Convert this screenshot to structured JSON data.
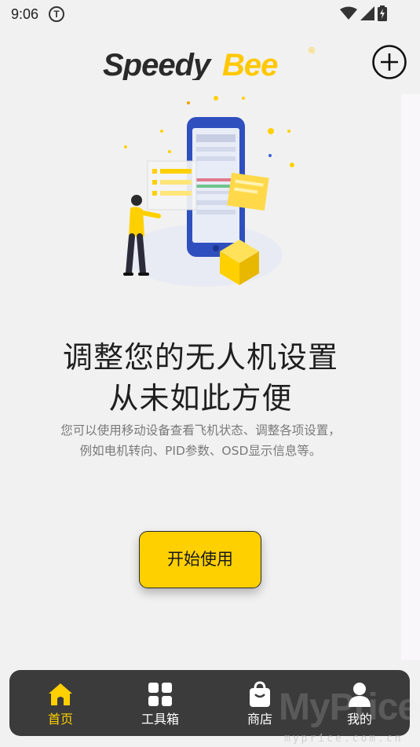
{
  "status_bar": {
    "time": "9:06",
    "carrier_icon": "T"
  },
  "header": {
    "brand_left": "Speedy",
    "brand_right": "Bee",
    "registered_mark": "®"
  },
  "main": {
    "headline_line1": "调整您的无人机设置",
    "headline_line2": "从未如此方便",
    "description_line1": "您可以使用移动设备查看飞机状态、调整各项设置，",
    "description_line2": "例如电机转向、PID参数、OSD显示信息等。",
    "start_button_label": "开始使用"
  },
  "tab_bar": {
    "tabs": [
      {
        "label": "首页",
        "icon": "home-icon",
        "active": true
      },
      {
        "label": "工具箱",
        "icon": "grid-icon",
        "active": false
      },
      {
        "label": "商店",
        "icon": "shopping-bag-icon",
        "active": false
      },
      {
        "label": "我的",
        "icon": "person-icon",
        "active": false
      }
    ]
  },
  "watermark": {
    "text": "MyPrice",
    "url_text": "myprice.com.cn"
  },
  "colors": {
    "accent": "#ffd000",
    "tabbar_bg": "#3b3b3b",
    "text_dark": "#1f1f1f",
    "text_muted": "#7a7a7a"
  }
}
